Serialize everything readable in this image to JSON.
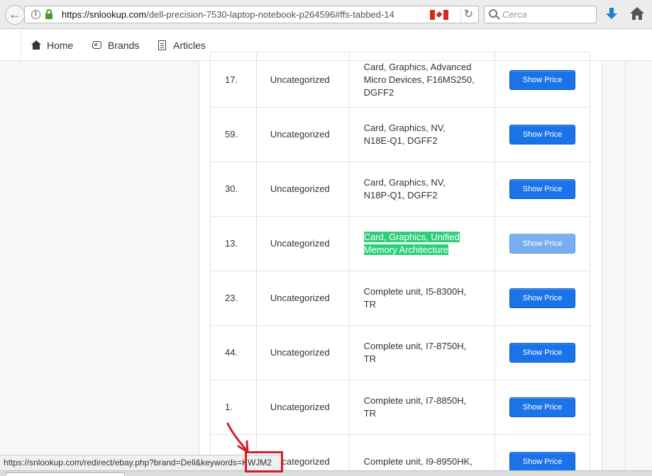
{
  "browser": {
    "url_host": "https://snlookup.com",
    "url_path": "/dell-precision-7530-laptop-notebook-p264596#ffs-tabbed-14",
    "search_placeholder": "Cerca",
    "flag": "canada-flag-icon",
    "colors": {
      "lock": "#4a9a2a",
      "download": "#1f7fd0"
    }
  },
  "nav": {
    "items": [
      {
        "label": "Home",
        "icon": "home-icon"
      },
      {
        "label": "Brands",
        "icon": "tag-icon"
      },
      {
        "label": "Articles",
        "icon": "document-icon"
      }
    ]
  },
  "table": {
    "rows": [
      {
        "num": "17.",
        "category": "Uncategorized",
        "desc_lines": [
          "Card, Graphics, Advanced",
          "Micro Devices, F16MS250,",
          "DGFF2"
        ],
        "button": "Show Price"
      },
      {
        "num": "59.",
        "category": "Uncategorized",
        "desc_lines": [
          "Card, Graphics, NV,",
          "N18E-Q1, DGFF2"
        ],
        "button": "Show Price"
      },
      {
        "num": "30.",
        "category": "Uncategorized",
        "desc_lines": [
          "Card, Graphics, NV,",
          "N18P-Q1, DGFF2"
        ],
        "button": "Show Price"
      },
      {
        "num": "13.",
        "category": "Uncategorized",
        "desc_lines": [
          "Card, Graphics, Unified",
          "Memory Architecture"
        ],
        "button": "Show Price",
        "highlighted": true,
        "button_hover": true
      },
      {
        "num": "23.",
        "category": "Uncategorized",
        "desc_lines": [
          "Complete unit, I5-8300H,",
          "TR"
        ],
        "button": "Show Price"
      },
      {
        "num": "44.",
        "category": "Uncategorized",
        "desc_lines": [
          "Complete unit, I7-8750H,",
          "TR"
        ],
        "button": "Show Price"
      },
      {
        "num": "1.",
        "category": "Uncategorized",
        "desc_lines": [
          "Complete unit, I7-8850H,",
          "TR"
        ],
        "button": "Show Price"
      },
      {
        "num": "",
        "category": "Uncategorized",
        "desc_lines": [
          "Complete unit, I9-8950HK,",
          ""
        ],
        "button": "Show Price"
      }
    ],
    "colors": {
      "button": "#1a73e8",
      "button_hover": "#78aef0",
      "highlight": "#2dcf7a"
    }
  },
  "status_bar": {
    "link": "https://snlookup.com/redirect/ebay.php?brand=Dell&keywords=KWJM2"
  },
  "annotation": {
    "color": "#d11f2a"
  }
}
